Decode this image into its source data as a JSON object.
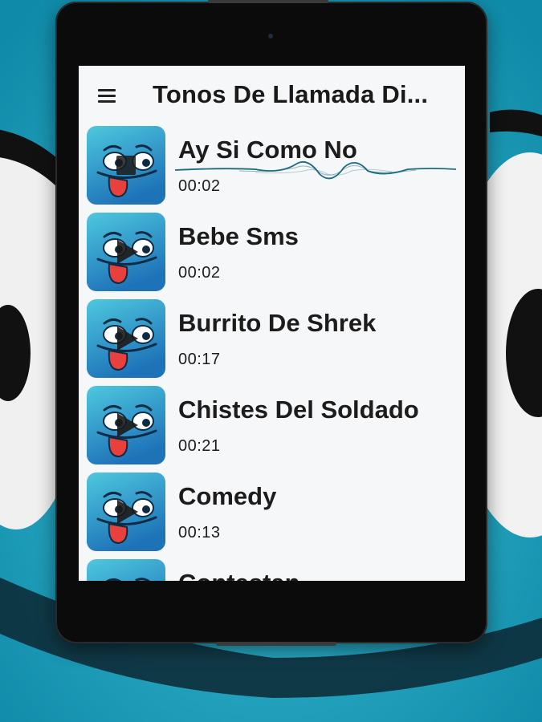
{
  "app": {
    "title": "Tonos De Llamada Di..."
  },
  "colors": {
    "background": "#1aa3c2",
    "thumb_gradient_top": "#4ec8df",
    "thumb_gradient_bottom": "#1e73b8",
    "tongue": "#e8403c",
    "wave": "#1b6b80"
  },
  "icons": {
    "menu": "hamburger-menu-icon",
    "thumb_face": "cartoon-face-icon",
    "thumb_play": "play-icon",
    "thumb_stop": "stop-icon",
    "waveform": "waveform-icon"
  },
  "ringtones": [
    {
      "title": "Ay Si Como No",
      "duration": "00:02",
      "playing": true
    },
    {
      "title": "Bebe Sms",
      "duration": "00:02",
      "playing": false
    },
    {
      "title": "Burrito De Shrek",
      "duration": "00:17",
      "playing": false
    },
    {
      "title": "Chistes Del Soldado",
      "duration": "00:21",
      "playing": false
    },
    {
      "title": "Comedy",
      "duration": "00:13",
      "playing": false
    },
    {
      "title": "Contestan",
      "duration": "",
      "playing": false
    }
  ]
}
